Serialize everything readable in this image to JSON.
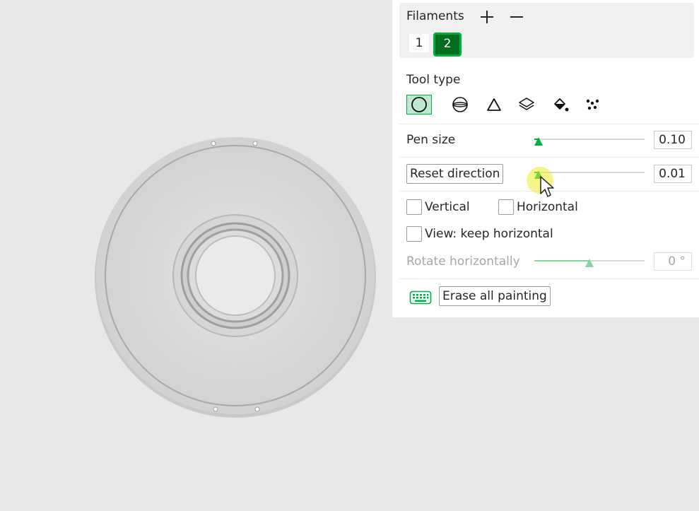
{
  "filaments": {
    "title": "Filaments",
    "add_icon": "plus-icon",
    "remove_icon": "minus-icon",
    "items": [
      {
        "label": "1",
        "selected": false,
        "color": "#ffffff"
      },
      {
        "label": "2",
        "selected": true,
        "color": "#006e1e"
      }
    ]
  },
  "tool_type": {
    "label": "Tool type",
    "tools": [
      {
        "icon": "circle-icon",
        "active": true
      },
      {
        "icon": "sphere-icon",
        "active": false
      },
      {
        "icon": "triangle-icon",
        "active": false
      },
      {
        "icon": "layers-icon",
        "active": false
      },
      {
        "icon": "fill-bucket-icon",
        "active": false
      },
      {
        "icon": "gap-fill-icon",
        "active": false
      }
    ]
  },
  "pen_size": {
    "label": "Pen size",
    "value": "0.10",
    "slider_fraction": 0.04
  },
  "reset_direction": {
    "button_label": "Reset direction",
    "value": "0.01",
    "slider_fraction": 0.04
  },
  "checkboxes": {
    "vertical": "Vertical",
    "horizontal": "Horizontal",
    "keep_horizontal": "View: keep horizontal"
  },
  "rotate": {
    "label": "Rotate horizontally",
    "value": "0 °",
    "slider_fraction": 0.5
  },
  "erase": {
    "button_label": "Erase all painting",
    "shortcut_icon": "keyboard-icon"
  },
  "colors": {
    "accent": "#00ae42",
    "selected_filament": "#006e1e",
    "viewport_bg": "#e8e8e8"
  }
}
